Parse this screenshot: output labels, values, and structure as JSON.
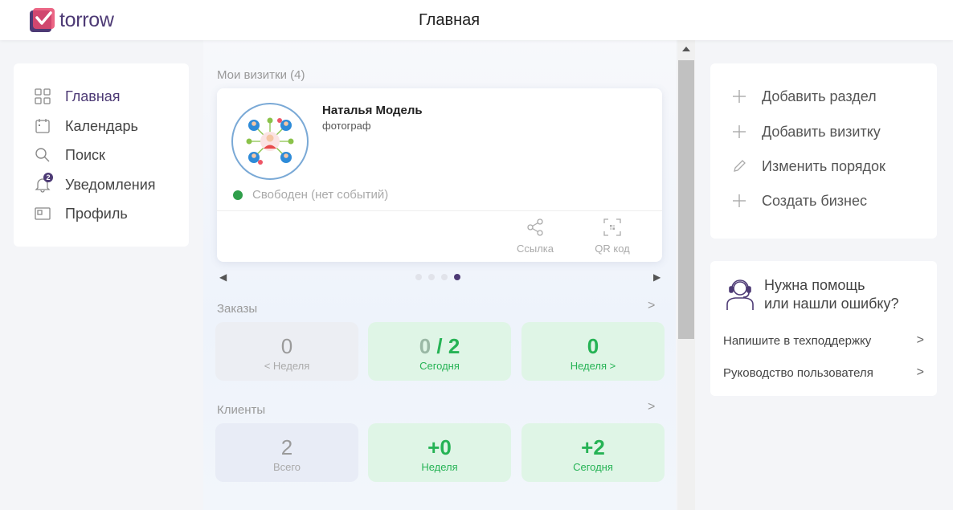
{
  "header": {
    "logo_text": "torrow",
    "title": "Главная"
  },
  "nav": {
    "items": [
      {
        "label": "Главная",
        "icon": "grid-icon",
        "active": true
      },
      {
        "label": "Календарь",
        "icon": "calendar-icon",
        "active": false
      },
      {
        "label": "Поиск",
        "icon": "search-icon",
        "active": false
      },
      {
        "label": "Уведомления",
        "icon": "bell-icon",
        "active": false,
        "badge": "2"
      },
      {
        "label": "Профиль",
        "icon": "profile-card-icon",
        "active": false
      }
    ]
  },
  "cards": {
    "section_label": "Мои визитки (4)",
    "card": {
      "name": "Наталья Модель",
      "role": "фотограф",
      "status": "Свободен (нет событий)",
      "status_color": "#2f9e4a",
      "actions": [
        {
          "label": "Ссылка",
          "icon": "share-icon"
        },
        {
          "label": "QR код",
          "icon": "qr-code-icon"
        }
      ]
    },
    "pager": {
      "total": 4,
      "current": 4
    }
  },
  "orders": {
    "label": "Заказы",
    "tiles": [
      {
        "value": "0",
        "caption": "< Неделя"
      },
      {
        "value_left": "0",
        "value_sep": " / ",
        "value_right": "2",
        "caption": "Сегодня"
      },
      {
        "value": "0",
        "caption": "Неделя >"
      }
    ]
  },
  "clients": {
    "label": "Клиенты",
    "tiles": [
      {
        "value": "2",
        "caption": "Всего"
      },
      {
        "value": "+0",
        "caption": "Неделя"
      },
      {
        "value": "+2",
        "caption": "Сегодня"
      }
    ]
  },
  "actions": {
    "items": [
      {
        "label": "Добавить раздел",
        "icon": "plus-icon"
      },
      {
        "label": "Добавить визитку",
        "icon": "plus-icon"
      },
      {
        "label": "Изменить порядок",
        "icon": "pencil-icon"
      },
      {
        "label": "Создать бизнес",
        "icon": "plus-icon"
      }
    ]
  },
  "help": {
    "title_line1": "Нужна помощь",
    "title_line2": "или нашли ошибку?",
    "links": [
      {
        "label": "Напишите в техподдержку"
      },
      {
        "label": "Руководство пользователя"
      }
    ]
  },
  "colors": {
    "brand": "#4d3a75",
    "green": "#26b355"
  }
}
